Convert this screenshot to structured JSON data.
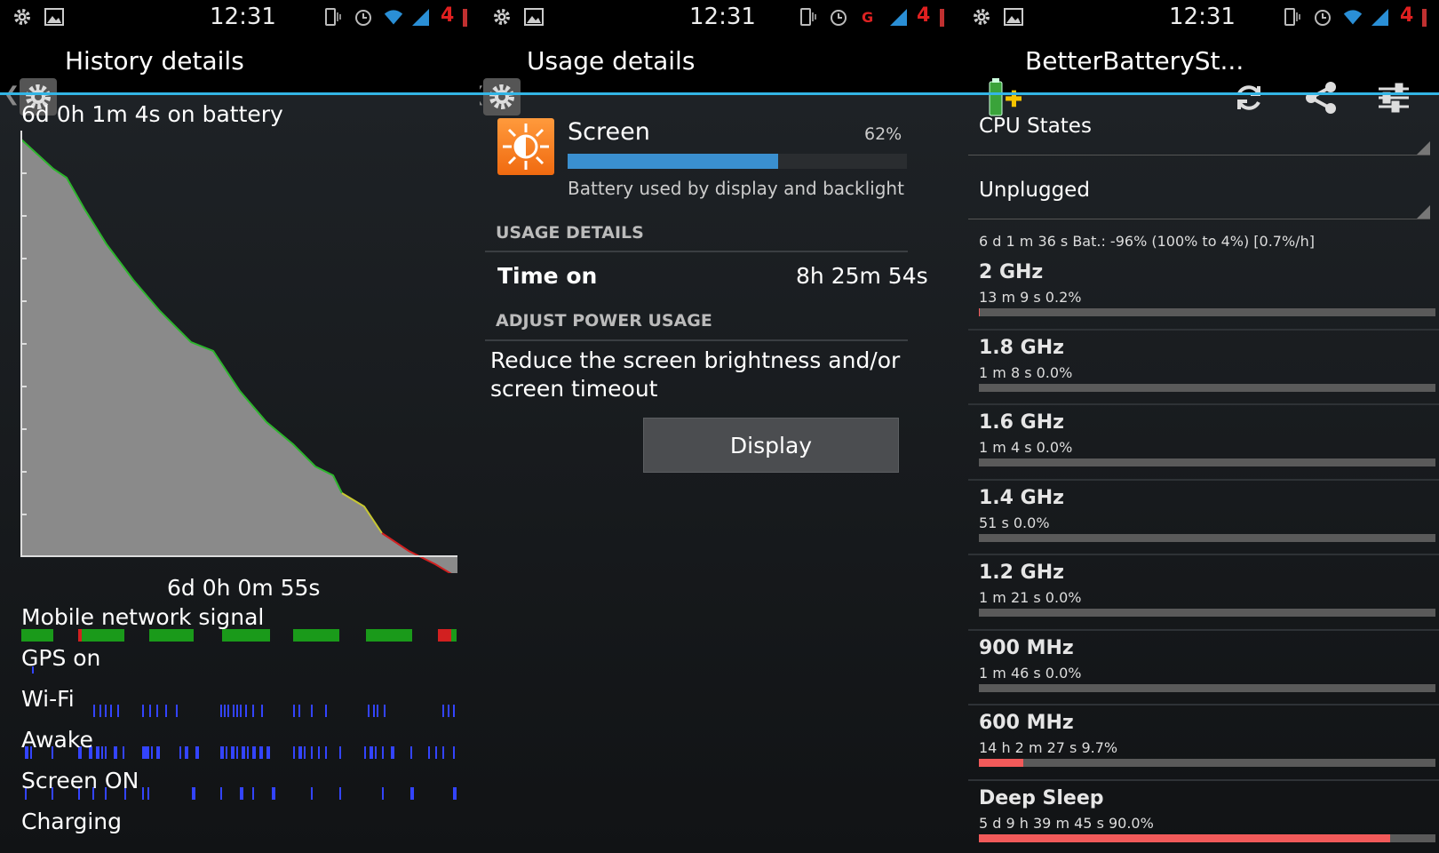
{
  "status_bar": {
    "time": "12:31",
    "badge": "4"
  },
  "history": {
    "title": "History details",
    "battery_time": "6d 0h 1m 4s on battery",
    "x_label": "6d 0h 0m 55s",
    "rows": [
      {
        "label": "Mobile network signal"
      },
      {
        "label": "GPS on"
      },
      {
        "label": "Wi-Fi"
      },
      {
        "label": "Awake"
      },
      {
        "label": "Screen ON"
      },
      {
        "label": "Charging"
      }
    ],
    "colors": {
      "fill": "#8a8a8a",
      "good": "#2db52d",
      "medium": "#c8c830",
      "bad": "#d22020",
      "ticks": "#3344ff"
    }
  },
  "usage": {
    "title": "Usage details",
    "item_name": "Screen",
    "item_percent": "62%",
    "item_fraction": 0.62,
    "item_desc": "Battery used by display and backlight",
    "usage_details_header": "USAGE DETAILS",
    "time_on_label": "Time on",
    "time_on_value": "8h 25m 54s",
    "adjust_header": "ADJUST POWER USAGE",
    "adjust_text_1": "Reduce the screen brightness and/or",
    "adjust_text_2": "screen timeout",
    "display_button": "Display",
    "accent_color": "#3a8fcf"
  },
  "bbs": {
    "title": "BetterBatterySt...",
    "spinner_1": "CPU States",
    "spinner_2": "Unplugged",
    "summary": "6 d 1 m 36 s  Bat.: -96% (100% to 4%) [0.7%/h]",
    "states": [
      {
        "freq": "2 GHz",
        "detail": "13 m 9 s  0.2%",
        "fraction": 0.002
      },
      {
        "freq": "1.8 GHz",
        "detail": "1 m 8 s  0.0%",
        "fraction": 0.0
      },
      {
        "freq": "1.6 GHz",
        "detail": "1 m 4 s  0.0%",
        "fraction": 0.0
      },
      {
        "freq": "1.4 GHz",
        "detail": "51 s  0.0%",
        "fraction": 0.0
      },
      {
        "freq": "1.2 GHz",
        "detail": "1 m 21 s  0.0%",
        "fraction": 0.0
      },
      {
        "freq": "900 MHz",
        "detail": "1 m 46 s  0.0%",
        "fraction": 0.0
      },
      {
        "freq": "600 MHz",
        "detail": "14 h 2 m 27 s  9.7%",
        "fraction": 0.097
      },
      {
        "freq": "Deep Sleep",
        "detail": "5 d 9 h 39 m 45 s  90.0%",
        "fraction": 0.9
      }
    ],
    "bar_color": "#f15a5a"
  }
}
